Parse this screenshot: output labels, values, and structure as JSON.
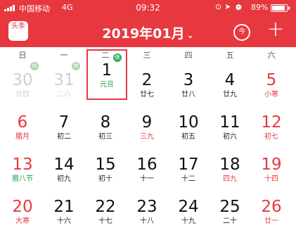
{
  "status_bar": {
    "carrier": "中国移动",
    "network": "4G",
    "time": "09:32",
    "icons": [
      "location-icon",
      "alarm-icon",
      "screen-rotation-lock-icon"
    ],
    "battery_percent": "89%",
    "battery_level": 0.89
  },
  "header": {
    "logo_text": "头条",
    "month_label": "2019年01月",
    "today_button_label": "今",
    "add_button_label": "+",
    "accent_color": "#e8383f"
  },
  "weekdays": [
    "日",
    "一",
    "二",
    "三",
    "四",
    "五",
    "六"
  ],
  "days": [
    {
      "num": "30",
      "lunar": "廿四",
      "type": "other",
      "badge": "休"
    },
    {
      "num": "31",
      "lunar": "二八",
      "type": "other",
      "badge": "休"
    },
    {
      "num": "1",
      "lunar": "元旦",
      "type": "today",
      "badge": "休"
    },
    {
      "num": "2",
      "lunar": "廿七",
      "type": "normal"
    },
    {
      "num": "3",
      "lunar": "廿八",
      "type": "normal"
    },
    {
      "num": "4",
      "lunar": "廿九",
      "type": "normal"
    },
    {
      "num": "5",
      "lunar": "小寒",
      "type": "weekend"
    },
    {
      "num": "6",
      "lunar": "腊月",
      "type": "weekend"
    },
    {
      "num": "7",
      "lunar": "初二",
      "type": "normal"
    },
    {
      "num": "8",
      "lunar": "初三",
      "type": "normal"
    },
    {
      "num": "9",
      "lunar": "三九",
      "type": "lunar-red"
    },
    {
      "num": "10",
      "lunar": "初五",
      "type": "normal"
    },
    {
      "num": "11",
      "lunar": "初六",
      "type": "normal"
    },
    {
      "num": "12",
      "lunar": "初七",
      "type": "weekend"
    },
    {
      "num": "13",
      "lunar": "腊八节",
      "type": "weekend-green"
    },
    {
      "num": "14",
      "lunar": "初九",
      "type": "normal"
    },
    {
      "num": "15",
      "lunar": "初十",
      "type": "normal"
    },
    {
      "num": "16",
      "lunar": "十一",
      "type": "normal"
    },
    {
      "num": "17",
      "lunar": "十二",
      "type": "normal"
    },
    {
      "num": "18",
      "lunar": "四九",
      "type": "lunar-red"
    },
    {
      "num": "19",
      "lunar": "十四",
      "type": "weekend"
    },
    {
      "num": "20",
      "lunar": "大寒",
      "type": "weekend"
    },
    {
      "num": "21",
      "lunar": "十六",
      "type": "normal"
    },
    {
      "num": "22",
      "lunar": "十七",
      "type": "normal"
    },
    {
      "num": "23",
      "lunar": "十八",
      "type": "normal"
    },
    {
      "num": "24",
      "lunar": "十九",
      "type": "normal"
    },
    {
      "num": "25",
      "lunar": "二十",
      "type": "normal"
    },
    {
      "num": "26",
      "lunar": "廿一",
      "type": "weekend"
    }
  ]
}
